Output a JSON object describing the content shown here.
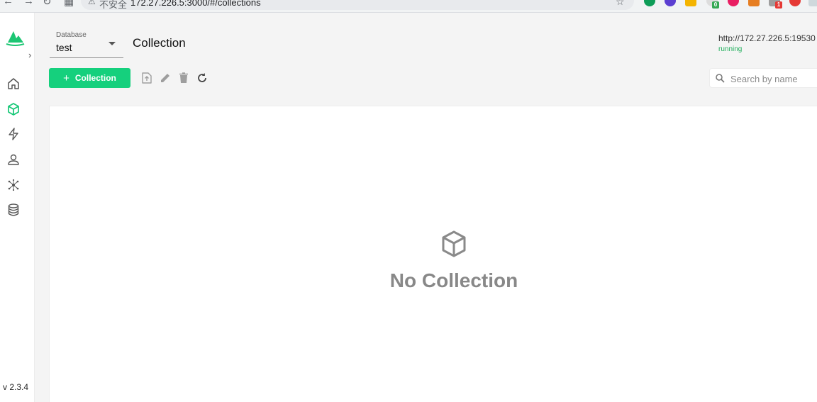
{
  "browser": {
    "omnibox_label": "不安全",
    "url": "172.27.226.5:3000/#/collections",
    "extension_badges": [
      "0",
      "1"
    ]
  },
  "sidebar": {
    "items": [
      {
        "icon": "home-icon",
        "active": false
      },
      {
        "icon": "cube-icon",
        "active": true
      },
      {
        "icon": "lightning-icon",
        "active": false
      },
      {
        "icon": "user-icon",
        "active": false
      },
      {
        "icon": "network-icon",
        "active": false
      },
      {
        "icon": "database-icon",
        "active": false
      }
    ],
    "version": "v 2.3.4"
  },
  "header": {
    "db_label": "Database",
    "db_value": "test",
    "title": "Collection",
    "server_url": "http://172.27.226.5:19530",
    "status": "running"
  },
  "toolbar": {
    "add_label": "Collection",
    "add_plus": "+",
    "tools": [
      "upload-icon",
      "edit-icon",
      "delete-icon",
      "refresh-icon"
    ]
  },
  "search": {
    "placeholder": "Search by name",
    "value": ""
  },
  "content": {
    "empty_text": "No Collection"
  },
  "colors": {
    "accent": "#15d07d",
    "status": "#1fad5a"
  }
}
